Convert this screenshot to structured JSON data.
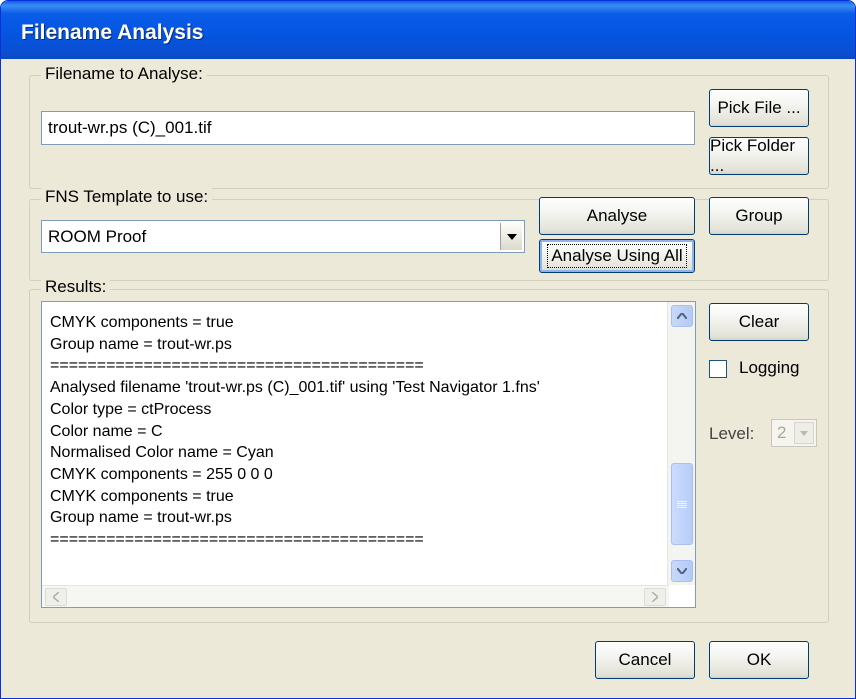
{
  "window": {
    "title": "Filename Analysis"
  },
  "filename_group": {
    "label": "Filename to Analyse:",
    "value": "trout-wr.ps (C)_001.tif",
    "pick_file_label": "Pick File ...",
    "pick_folder_label": "Pick Folder ..."
  },
  "template_group": {
    "label": "FNS Template to use:",
    "selected": "ROOM Proof",
    "analyse_label": "Analyse",
    "analyse_all_label": "Analyse Using All",
    "group_label": "Group"
  },
  "results_group": {
    "label": "Results:",
    "lines": [
      "CMYK components = true",
      "Group name = trout-wr.ps",
      "========================================",
      "Analysed filename 'trout-wr.ps (C)_001.tif' using 'Test Navigator 1.fns'",
      "Color type = ctProcess",
      "Color name = C",
      "Normalised Color name = Cyan",
      "CMYK components = 255 0 0 0",
      "CMYK components = true",
      "Group name = trout-wr.ps",
      "========================================"
    ],
    "scroll_position": 0.92,
    "clear_label": "Clear",
    "logging_label": "Logging",
    "logging_checked": false,
    "level_label": "Level:",
    "level_value": "2"
  },
  "footer": {
    "cancel_label": "Cancel",
    "ok_label": "OK"
  },
  "icons": {
    "up": "scroll-up-arrow-icon",
    "down": "scroll-down-arrow-icon",
    "left": "scroll-left-arrow-icon",
    "right": "scroll-right-arrow-icon",
    "dropdown": "dropdown-arrow-icon"
  },
  "colors": {
    "title_bar": "#0454e0",
    "face": "#ece9d8",
    "button_border": "#003c74"
  }
}
